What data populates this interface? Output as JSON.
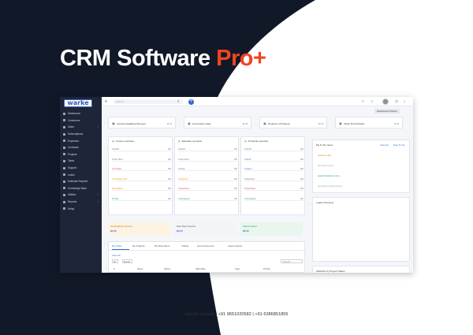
{
  "hero": {
    "title_main": "CRM Software ",
    "title_accent": "Pro+"
  },
  "footer": {
    "contact": "Adarsh Jaiswal | +91 9651020582 | +91 6386851855"
  },
  "colors": {
    "dark_bg": "#111827",
    "accent": "#f0441f",
    "sidebar": "#1f2538",
    "primary": "#2f6bd8"
  },
  "app": {
    "logo": "warke",
    "sidebar": {
      "items": [
        {
          "label": "Dashboard",
          "icon": "home-icon",
          "has_submenu": false
        },
        {
          "label": "Customers",
          "icon": "users-icon",
          "has_submenu": false
        },
        {
          "label": "Sales",
          "icon": "cart-icon",
          "has_submenu": true
        },
        {
          "label": "Subscriptions",
          "icon": "refresh-icon",
          "has_submenu": false
        },
        {
          "label": "Expenses",
          "icon": "receipt-icon",
          "has_submenu": false
        },
        {
          "label": "Contracts",
          "icon": "file-icon",
          "has_submenu": false
        },
        {
          "label": "Projects",
          "icon": "folder-icon",
          "has_submenu": false
        },
        {
          "label": "Tasks",
          "icon": "check-icon",
          "has_submenu": false
        },
        {
          "label": "Support",
          "icon": "support-icon",
          "has_submenu": false
        },
        {
          "label": "Leads",
          "icon": "tag-icon",
          "has_submenu": false
        },
        {
          "label": "Estimate Request",
          "icon": "request-icon",
          "has_submenu": false
        },
        {
          "label": "Knowledge Base",
          "icon": "book-icon",
          "has_submenu": false
        },
        {
          "label": "Utilities",
          "icon": "tool-icon",
          "has_submenu": true
        },
        {
          "label": "Reports",
          "icon": "chart-icon",
          "has_submenu": true
        },
        {
          "label": "Setup",
          "icon": "gear-icon",
          "has_submenu": false
        }
      ]
    },
    "topbar": {
      "search_placeholder": "Search...",
      "plus": "+"
    },
    "dashboard_options": "Dashboard Options",
    "stats": [
      {
        "label": "Invoices Awaiting Payment",
        "value": "0 / 0",
        "icon": "invoice-icon"
      },
      {
        "label": "Converted Leads",
        "value": "0 / 0",
        "icon": "trend-icon"
      },
      {
        "label": "Projects In Progress",
        "value": "0 / 0",
        "icon": "project-icon"
      },
      {
        "label": "Tasks Not Finished",
        "value": "0 / 0",
        "icon": "task-icon"
      }
    ],
    "overviews": [
      {
        "title": "Invoice overview",
        "rows": [
          {
            "label": "0 Draft",
            "count": "0%",
            "color": "#6b7280"
          },
          {
            "label": "0 Not Sent",
            "count": "0%",
            "color": "#6b7280"
          },
          {
            "label": "0 Unpaid",
            "count": "0%",
            "color": "#e5484d"
          },
          {
            "label": "0 Partially Paid",
            "count": "0%",
            "color": "#f59e0b"
          },
          {
            "label": "0 Overdue",
            "count": "0%",
            "color": "#f97316"
          },
          {
            "label": "0 Paid",
            "count": "0%",
            "color": "#22a05b"
          }
        ]
      },
      {
        "title": "Estimate overview",
        "rows": [
          {
            "label": "0 Draft",
            "count": "0%",
            "color": "#6b7280"
          },
          {
            "label": "0 Not Sent",
            "count": "0%",
            "color": "#6b7280"
          },
          {
            "label": "0 Sent",
            "count": "0%",
            "color": "#2f6bd8"
          },
          {
            "label": "0 Expired",
            "count": "0%",
            "color": "#f59e0b"
          },
          {
            "label": "0 Declined",
            "count": "0%",
            "color": "#e5484d"
          },
          {
            "label": "0 Accepted",
            "count": "0%",
            "color": "#22a05b"
          }
        ]
      },
      {
        "title": "Proposal overview",
        "rows": [
          {
            "label": "0 Draft",
            "count": "0%",
            "color": "#6b7280"
          },
          {
            "label": "0 Sent",
            "count": "0%",
            "color": "#2f6bd8"
          },
          {
            "label": "0 Open",
            "count": "0%",
            "color": "#2f6bd8"
          },
          {
            "label": "0 Revised",
            "count": "0%",
            "color": "#6b7280"
          },
          {
            "label": "0 Declined",
            "count": "0%",
            "color": "#e5484d"
          },
          {
            "label": "0 Accepted",
            "count": "0%",
            "color": "#22a05b"
          }
        ]
      }
    ],
    "summaries": [
      {
        "title": "Outstanding Invoices",
        "value": "$0.00",
        "bg": "#fdf3e2",
        "fg": "#d97706"
      },
      {
        "title": "Past Due Invoices",
        "value": "$0.00",
        "bg": "#f3f4f6",
        "fg": "#555555"
      },
      {
        "title": "Paid Invoices",
        "value": "$0.00",
        "bg": "#e8f6ee",
        "fg": "#22a05b"
      }
    ],
    "tabs": [
      "My Tasks",
      "My Projects",
      "My Reminders",
      "Tickets",
      "Announcements",
      "Latest Activity"
    ],
    "tasks_table": {
      "view_all": "View All",
      "page_size": "10",
      "export": "Export",
      "search_placeholder": "Search...",
      "columns": [
        "#",
        "Name",
        "Status",
        "Start Date",
        "Tags",
        "Priority"
      ]
    },
    "todos": {
      "title": "My To Do Items",
      "view_all": "View All",
      "new": "New To Do",
      "latest_label": "Latest to do's",
      "no_todos": "No todos found",
      "finished_label": "Latest finished to do's",
      "no_finished": "No finished todos found"
    },
    "leads": {
      "title": "Leads Overview",
      "legend": [
        {
          "label": "Customer",
          "color": "#22a05b"
        },
        {
          "label": "Lost",
          "color": "#e5484d"
        }
      ]
    },
    "stats_by_project": "Statistics by Project Status"
  }
}
